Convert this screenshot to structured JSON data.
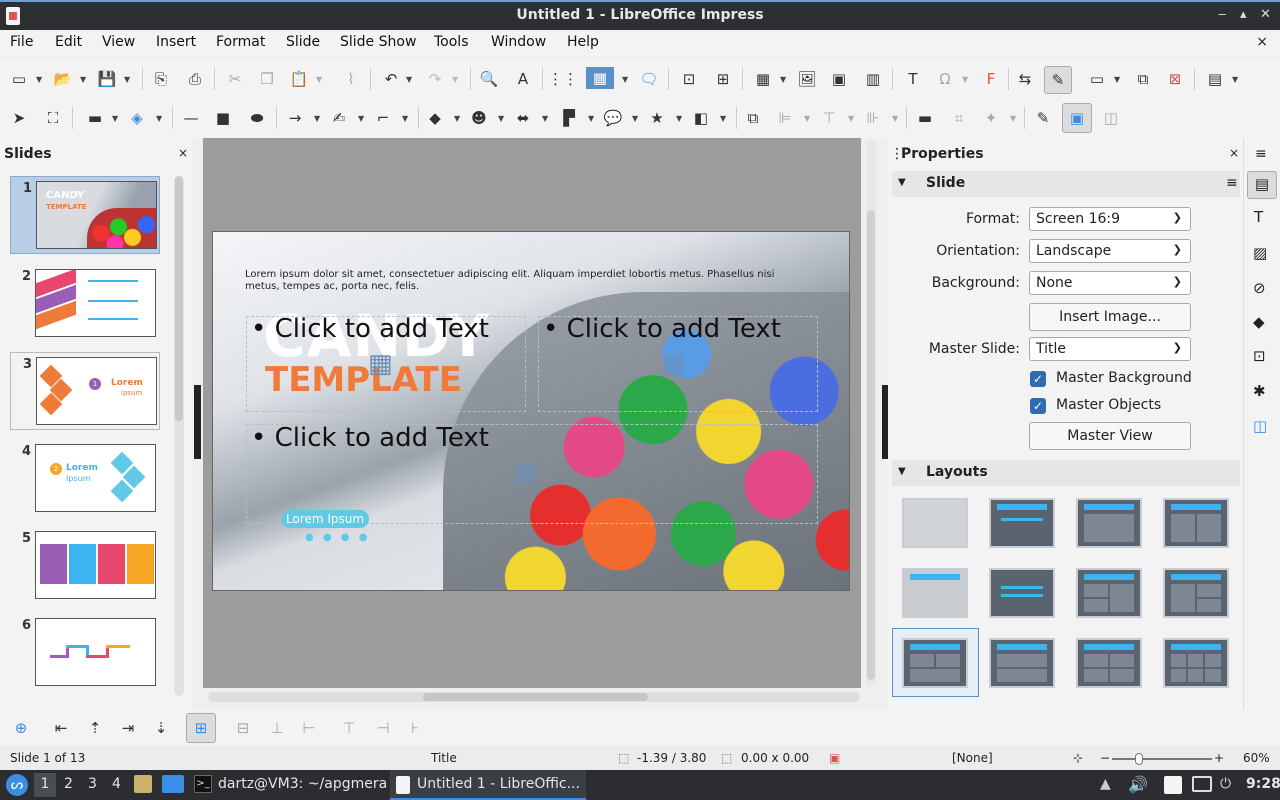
{
  "window": {
    "title": "Untitled 1 - LibreOffice Impress",
    "min": "‒",
    "max": "▴",
    "close": "✕"
  },
  "menu": [
    "File",
    "Edit",
    "View",
    "Insert",
    "Format",
    "Slide",
    "Slide Show",
    "Tools",
    "Window",
    "Help"
  ],
  "menu_close": "×",
  "slides_panel": {
    "title": "Slides",
    "close": "×",
    "thumbs": [
      {
        "num": "1",
        "title": "CANDY",
        "subtitle": "TEMPLATE"
      },
      {
        "num": "2"
      },
      {
        "num": "3",
        "title": "Lorem",
        "subtitle": "ipsum",
        "badge": "1"
      },
      {
        "num": "4",
        "title": "Lorem",
        "subtitle": "Ipsum",
        "badge": "2"
      },
      {
        "num": "5"
      },
      {
        "num": "6"
      }
    ]
  },
  "slide": {
    "body_text": "Lorem ipsum dolor sit amet, consectetuer adipiscing elit. Aliquam imperdiet lobortis metus. Phasellus nisi metus, tempes ac, porta nec, felis.",
    "title": "CANDY",
    "subtitle": "TEMPLATE",
    "placeholder_1": "• Click to add Text",
    "placeholder_2": "• Click to add Text",
    "placeholder_3": "• Click to add Text",
    "button": "Lorem Ipsum"
  },
  "properties": {
    "title": "Properties",
    "close": "×",
    "menu": "≡",
    "slide_section": "Slide",
    "format_label": "Format:",
    "format_value": "Screen 16:9",
    "orientation_label": "Orientation:",
    "orientation_value": "Landscape",
    "background_label": "Background:",
    "background_value": "None",
    "insert_image": "Insert Image...",
    "master_label": "Master Slide:",
    "master_value": "Title",
    "master_background": "Master Background",
    "master_objects": "Master Objects",
    "master_view": "Master View",
    "layouts_section": "Layouts"
  },
  "status": {
    "slide_counter": "Slide 1 of 13",
    "master": "Title",
    "position": "-1.39 / 3.80",
    "size": "0.00 x 0.00",
    "selection": "[None]",
    "zoom": "60%"
  },
  "taskbar": {
    "workspaces": [
      "1",
      "2",
      "3",
      "4"
    ],
    "terminal": "dartz@VM3: ~/apgmera",
    "impress": "Untitled 1 - LibreOffic...",
    "time": "9:28"
  },
  "colors": {
    "accent": "#3db4f2",
    "orange": "#f07a3a",
    "titlebar": "#2d2f33"
  }
}
